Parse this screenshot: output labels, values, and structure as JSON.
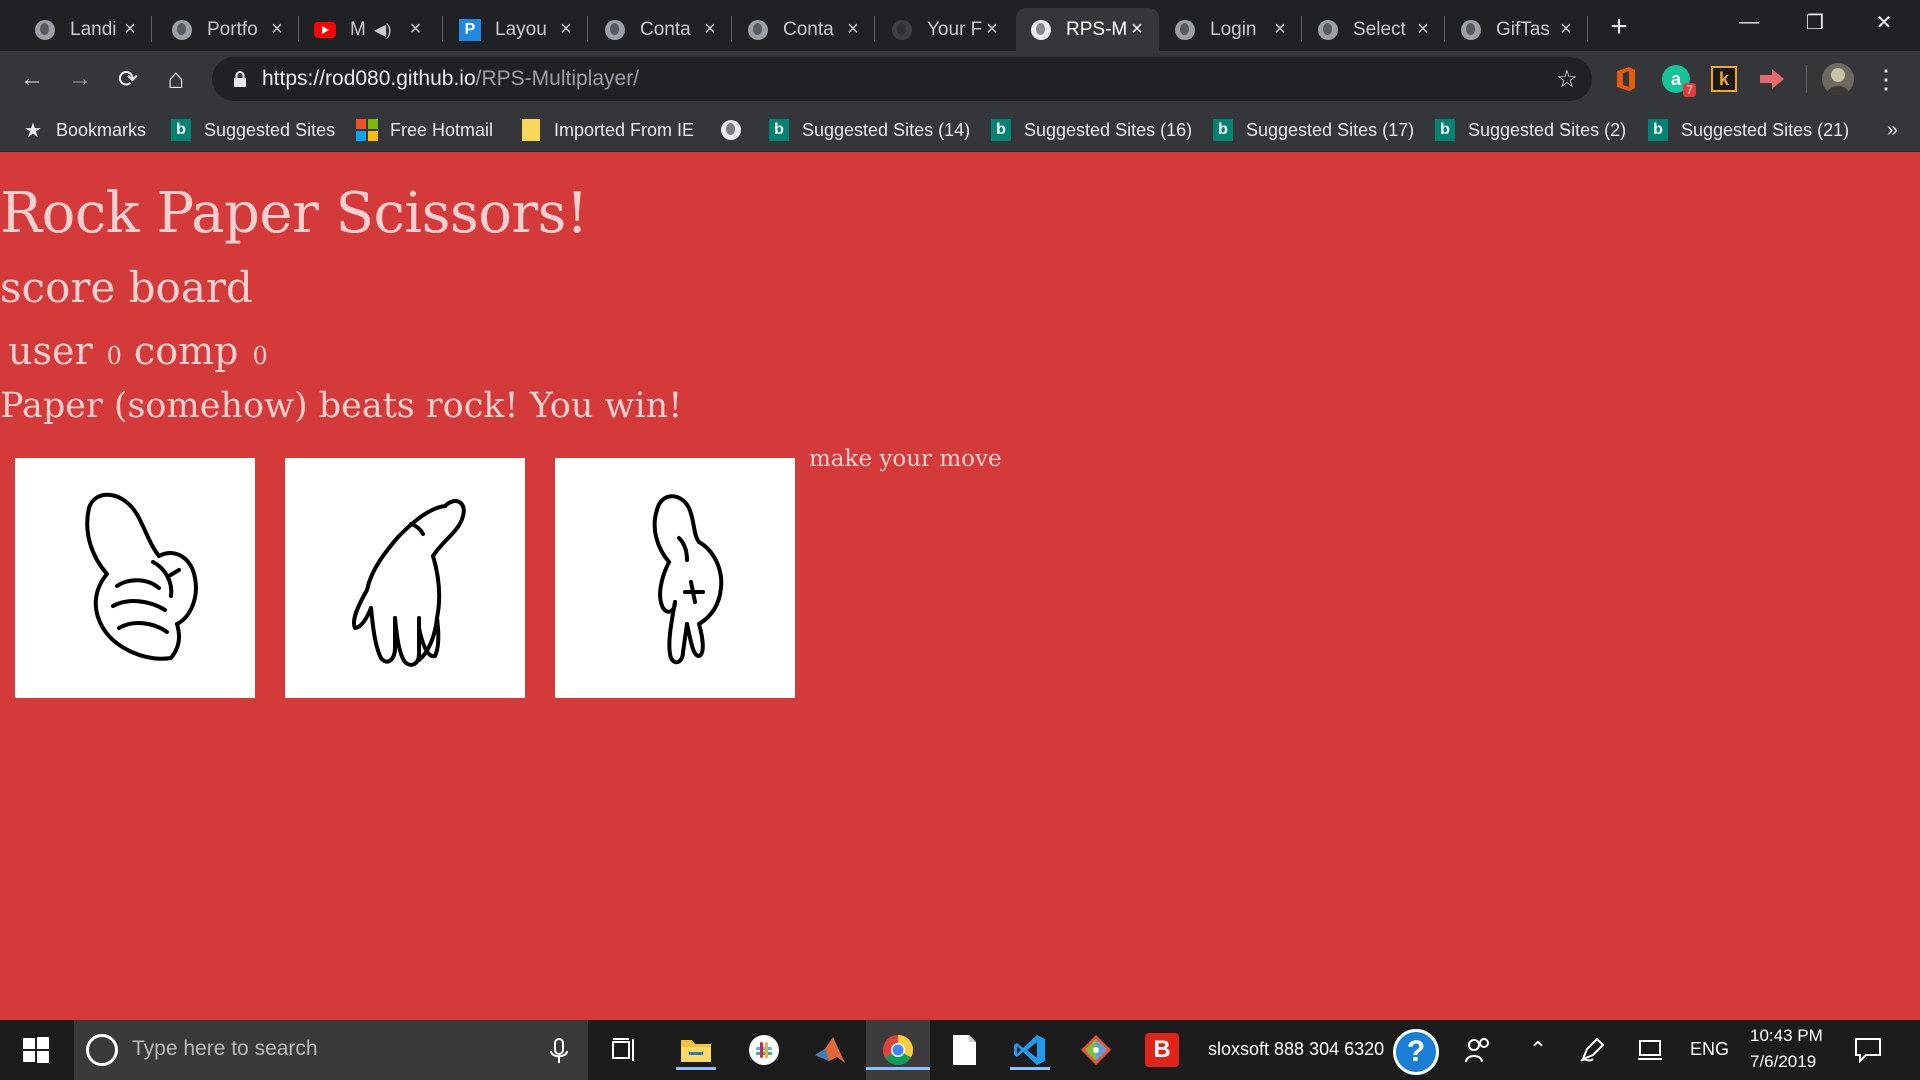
{
  "browser": {
    "tabs": [
      {
        "title": "Landi",
        "icon": "globe-icon",
        "active": false
      },
      {
        "title": "Portfo",
        "icon": "globe-icon",
        "active": false
      },
      {
        "title": "M",
        "icon": "youtube-icon",
        "active": false,
        "audio": true
      },
      {
        "title": "Layou",
        "icon": "p-icon",
        "active": false
      },
      {
        "title": "Conta",
        "icon": "globe-icon",
        "active": false
      },
      {
        "title": "Conta",
        "icon": "globe-icon",
        "active": false
      },
      {
        "title": "Your F",
        "icon": "github-icon",
        "active": false
      },
      {
        "title": "RPS-M",
        "icon": "globe-icon",
        "active": true
      },
      {
        "title": "Login",
        "icon": "globe-icon",
        "active": false
      },
      {
        "title": "Select",
        "icon": "globe-icon",
        "active": false
      },
      {
        "title": "GifTas",
        "icon": "globe-icon",
        "active": false
      }
    ],
    "new_tab_label": "+",
    "window_controls": {
      "minimize": "—",
      "maximize": "❐",
      "close": "✕"
    },
    "toolbar": {
      "back": "←",
      "forward": "→",
      "reload": "⟳",
      "home": "⌂",
      "menu": "⋮"
    },
    "url": {
      "host": "https://rod080.github.io",
      "path": "/RPS-Multiplayer/"
    },
    "extensions": [
      {
        "name": "office-icon",
        "label": "",
        "color": "#e8590c"
      },
      {
        "name": "grammarly-icon",
        "label": "a",
        "badge": "7",
        "color": "#15c39a"
      },
      {
        "name": "keepa-icon",
        "label": "k",
        "color": "#f5a623"
      },
      {
        "name": "arrow-extension-icon",
        "label": "",
        "color": "#e86a6a"
      }
    ],
    "bookmarks": [
      {
        "label": "Bookmarks",
        "icon": "star-icon"
      },
      {
        "label": "Suggested Sites",
        "icon": "bing-icon"
      },
      {
        "label": "Free Hotmail",
        "icon": "microsoft-icon"
      },
      {
        "label": "Imported From IE",
        "icon": "folder-icon"
      },
      {
        "label": "",
        "icon": "globe-icon"
      },
      {
        "label": "Suggested Sites (14)",
        "icon": "bing-icon"
      },
      {
        "label": "Suggested Sites (16)",
        "icon": "bing-icon"
      },
      {
        "label": "Suggested Sites (17)",
        "icon": "bing-icon"
      },
      {
        "label": "Suggested Sites (2)",
        "icon": "bing-icon"
      },
      {
        "label": "Suggested Sites (21)",
        "icon": "bing-icon"
      }
    ],
    "bookmarks_more": "»"
  },
  "page": {
    "title": "Rock Paper Scissors!",
    "scoreboard_heading": "score board",
    "user_label": "user",
    "user_score": "0",
    "comp_label": "comp",
    "comp_score": "0",
    "result_message": "Paper (somehow) beats rock! You win!",
    "prompt": "make your move",
    "choices": [
      {
        "name": "rock",
        "icon": "rock-hand-icon"
      },
      {
        "name": "paper",
        "icon": "paper-hand-icon"
      },
      {
        "name": "scissors",
        "icon": "scissors-hand-icon"
      }
    ],
    "colors": {
      "background": "#d53a3a",
      "text": "#f7d0cf"
    }
  },
  "taskbar": {
    "search_placeholder": "Type here to search",
    "pinned_apps": [
      "start-icon",
      "task-view-icon",
      "file-explorer-icon",
      "slack-icon",
      "matlab-icon",
      "chrome-icon",
      "notepad-icon",
      "vscode-icon",
      "git-icon",
      "bitdefender-icon"
    ],
    "support_text": "sloxsoft 888 304 6320",
    "language": "ENG",
    "time": "10:43 PM",
    "date": "7/6/2019"
  }
}
